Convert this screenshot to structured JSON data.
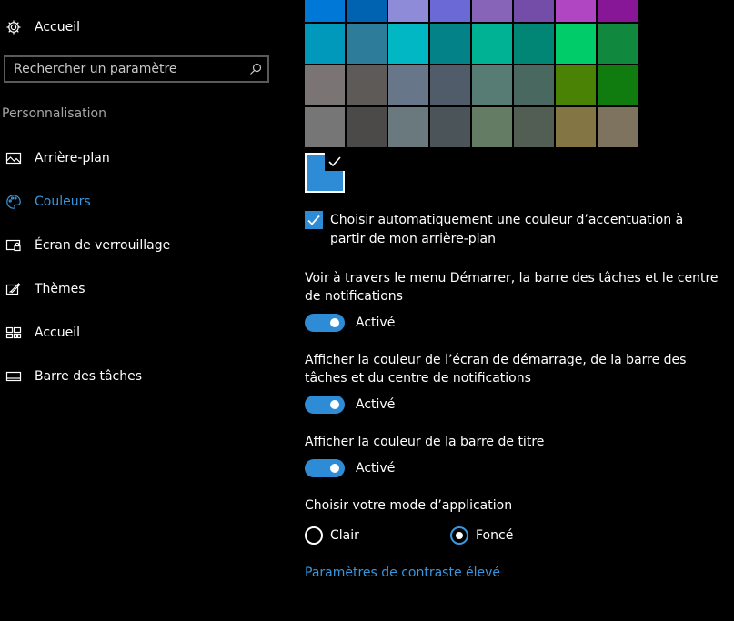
{
  "sidebar": {
    "home": {
      "label": "Accueil",
      "icon": "gear-icon"
    },
    "search": {
      "placeholder": "Rechercher un paramètre",
      "icon": "search-icon"
    },
    "section_title": "Personnalisation",
    "items": [
      {
        "label": "Arrière-plan",
        "icon": "picture-icon",
        "active": false
      },
      {
        "label": "Couleurs",
        "icon": "palette-icon",
        "active": true
      },
      {
        "label": "Écran de verrouillage",
        "icon": "lock-screen-icon",
        "active": false
      },
      {
        "label": "Thèmes",
        "icon": "brush-icon",
        "active": false
      },
      {
        "label": "Accueil",
        "icon": "start-tiles-icon",
        "active": false
      },
      {
        "label": "Barre des tâches",
        "icon": "taskbar-icon",
        "active": false
      }
    ],
    "active_color": "#3a96dd"
  },
  "colors": {
    "palette_rows": [
      [
        "#0078d7",
        "#0063b1",
        "#8e8cd8",
        "#6b69d6",
        "#8764b8",
        "#744da9",
        "#b146c2",
        "#881798"
      ],
      [
        "#0099bc",
        "#2d7d9a",
        "#00b7c3",
        "#038387",
        "#00b294",
        "#018574",
        "#00cc6a",
        "#10893e"
      ],
      [
        "#7a7574",
        "#5d5a58",
        "#68768a",
        "#515c6b",
        "#567c73",
        "#486860",
        "#498205",
        "#107c10"
      ],
      [
        "#767676",
        "#4c4a48",
        "#69797e",
        "#4a5459",
        "#647c64",
        "#525e54",
        "#847545",
        "#7e735f"
      ]
    ],
    "current_accent": "#2e8bd6",
    "auto_accent": {
      "checked": true,
      "label": "Choisir automatiquement une couleur d’accentuation à partir de mon arrière-plan"
    },
    "transparency": {
      "description": "Voir à travers le menu Démarrer, la barre des tâches et le centre de notifications",
      "state": "Activé",
      "on": true
    },
    "start_taskbar_color": {
      "description": "Afficher la couleur de l’écran de démarrage, de la barre des tâches et du centre de notifications",
      "state": "Activé",
      "on": true
    },
    "title_bar_color": {
      "description": "Afficher la couleur de la barre de titre",
      "state": "Activé",
      "on": true
    },
    "app_mode": {
      "title": "Choisir votre mode d’application",
      "options": [
        {
          "label": "Clair",
          "selected": false
        },
        {
          "label": "Foncé",
          "selected": true
        }
      ]
    },
    "high_contrast_link": "Paramètres de contraste élevé"
  }
}
